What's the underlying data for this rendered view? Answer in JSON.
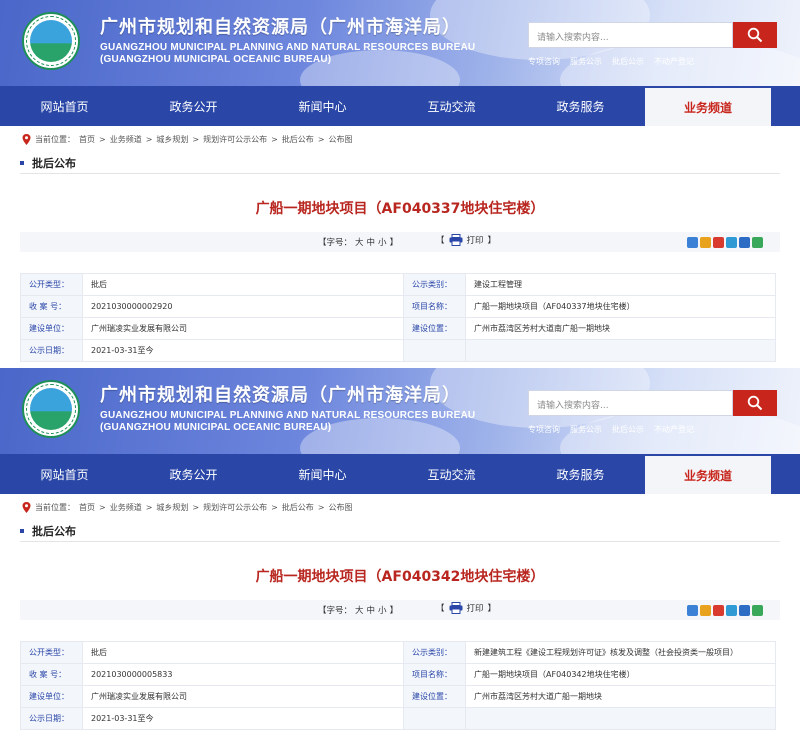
{
  "header": {
    "title_cn": "广州市规划和自然资源局（广州市海洋局）",
    "title_en_line1": "GUANGZHOU MUNICIPAL PLANNING AND NATURAL RESOURCES BUREAU",
    "title_en_line2": "(GUANGZHOU MUNICIPAL OCEANIC BUREAU)",
    "search_placeholder": "请输入搜索内容...",
    "quick_links": [
      "专项咨询",
      "服务公示",
      "批后公示",
      "不动产登记"
    ]
  },
  "nav": {
    "items": [
      "网站首页",
      "政务公开",
      "新闻中心",
      "互动交流",
      "政务服务",
      "业务频道"
    ],
    "active_index": 5
  },
  "breadcrumb": {
    "label": "当前位置：",
    "items": [
      "首页",
      "业务频道",
      "城乡规划",
      "规划许可公示公布",
      "批后公布",
      "公布图"
    ],
    "separator": ">"
  },
  "section": {
    "title": "批后公布"
  },
  "toolbar": {
    "font_size_label": "【字号：",
    "font_sizes": [
      "大",
      "中",
      "小"
    ],
    "font_size_close": "】",
    "print_label": "打印",
    "print_open": "【",
    "print_close": "】"
  },
  "labels": {
    "open_type": "公开类型：",
    "serial": "收 案 号：",
    "builder": "建设单位：",
    "pub_date": "公示日期：",
    "pub_category": "公示类别：",
    "project_name": "项目名称：",
    "location": "建设位置："
  },
  "records": [
    {
      "project_title": "广船一期地块项目（AF040337地块住宅楼）",
      "open_type": "批后",
      "serial": "2021030000002920",
      "builder": "广州瑞凌实业发展有限公司",
      "pub_date": "2021-03-31至今",
      "pub_category": "建设工程管理",
      "project_name": "广船一期地块项目（AF040337地块住宅楼）",
      "location": "广州市荔湾区芳村大道南广船一期地块"
    },
    {
      "project_title": "广船一期地块项目（AF040342地块住宅楼）",
      "open_type": "批后",
      "serial": "2021030000005833",
      "builder": "广州瑞凌实业发展有限公司",
      "pub_date": "2021-03-31至今",
      "pub_category": "新建建筑工程《建设工程规划许可证》核发及调整（社会投资类一般项目）",
      "project_name": "广船一期地块项目（AF040342地块住宅楼）",
      "location": "广州市荔湾区芳村大道广船一期地块"
    }
  ],
  "colors": {
    "nav_blue": "#2a47a8",
    "title_red": "#b8261f",
    "search_red": "#c8261c",
    "label_blue": "#2a47a8"
  },
  "icons": [
    "location-pin-icon",
    "search-icon",
    "printer-icon",
    "share-icon"
  ]
}
